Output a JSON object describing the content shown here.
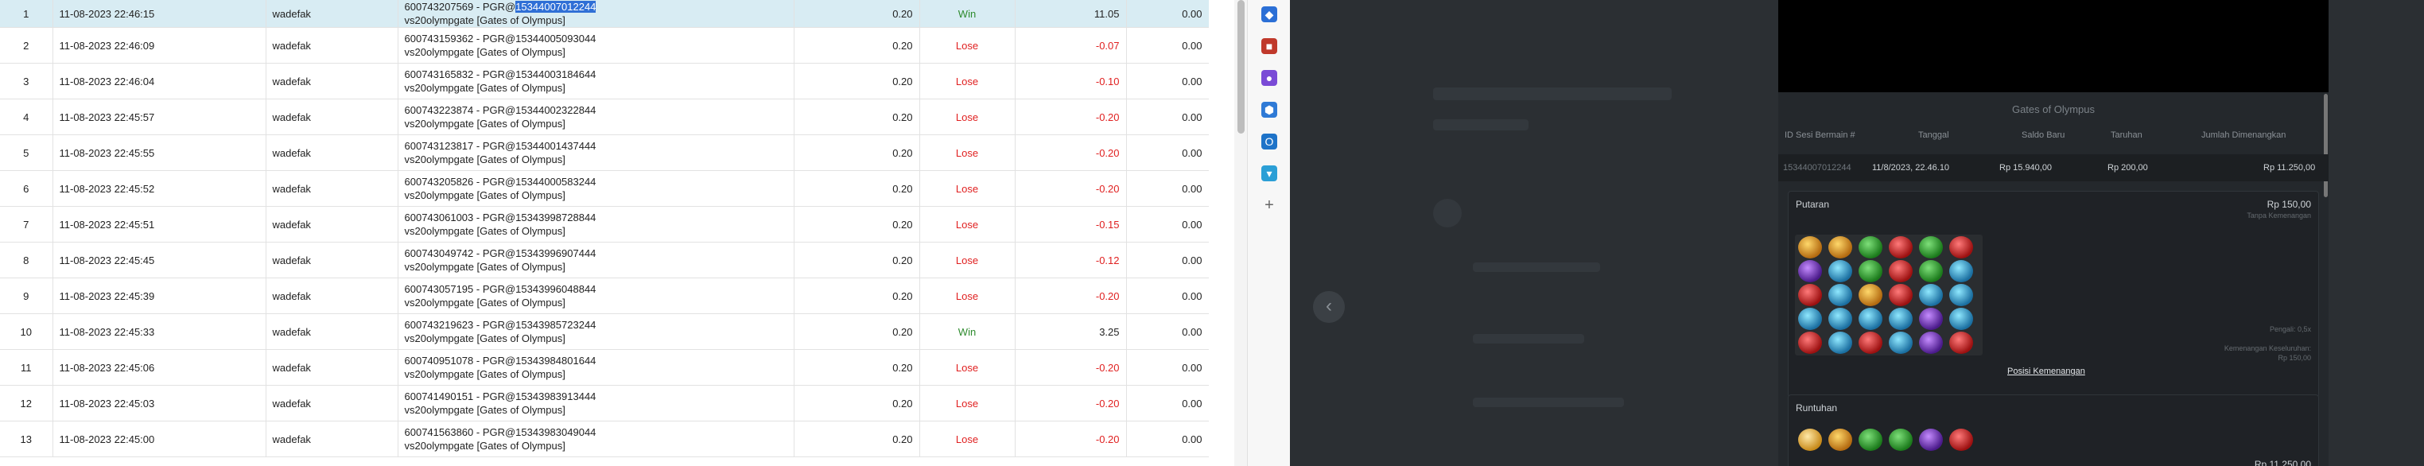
{
  "table": {
    "rows": [
      {
        "no": "1",
        "date": "11-08-2023 22:46:15",
        "user": "wadefak",
        "desc_prefix": "600743207569 - PGR@",
        "desc_hl": "15344007012244",
        "desc2": "vs20olympgate [Gates of Olympus]",
        "bet": "0.20",
        "result": "Win",
        "amount": "11.05",
        "balance": "0.00"
      },
      {
        "no": "2",
        "date": "11-08-2023 22:46:09",
        "user": "wadefak",
        "desc_prefix": "600743159362 - PGR@15344005093044",
        "desc_hl": "",
        "desc2": "vs20olympgate [Gates of Olympus]",
        "bet": "0.20",
        "result": "Lose",
        "amount": "-0.07",
        "balance": "0.00"
      },
      {
        "no": "3",
        "date": "11-08-2023 22:46:04",
        "user": "wadefak",
        "desc_prefix": "600743165832 - PGR@15344003184644",
        "desc_hl": "",
        "desc2": "vs20olympgate [Gates of Olympus]",
        "bet": "0.20",
        "result": "Lose",
        "amount": "-0.10",
        "balance": "0.00"
      },
      {
        "no": "4",
        "date": "11-08-2023 22:45:57",
        "user": "wadefak",
        "desc_prefix": "600743223874 - PGR@15344002322844",
        "desc_hl": "",
        "desc2": "vs20olympgate [Gates of Olympus]",
        "bet": "0.20",
        "result": "Lose",
        "amount": "-0.20",
        "balance": "0.00"
      },
      {
        "no": "5",
        "date": "11-08-2023 22:45:55",
        "user": "wadefak",
        "desc_prefix": "600743123817 - PGR@15344001437444",
        "desc_hl": "",
        "desc2": "vs20olympgate [Gates of Olympus]",
        "bet": "0.20",
        "result": "Lose",
        "amount": "-0.20",
        "balance": "0.00"
      },
      {
        "no": "6",
        "date": "11-08-2023 22:45:52",
        "user": "wadefak",
        "desc_prefix": "600743205826 - PGR@15344000583244",
        "desc_hl": "",
        "desc2": "vs20olympgate [Gates of Olympus]",
        "bet": "0.20",
        "result": "Lose",
        "amount": "-0.20",
        "balance": "0.00"
      },
      {
        "no": "7",
        "date": "11-08-2023 22:45:51",
        "user": "wadefak",
        "desc_prefix": "600743061003 - PGR@15343998728844",
        "desc_hl": "",
        "desc2": "vs20olympgate [Gates of Olympus]",
        "bet": "0.20",
        "result": "Lose",
        "amount": "-0.15",
        "balance": "0.00"
      },
      {
        "no": "8",
        "date": "11-08-2023 22:45:45",
        "user": "wadefak",
        "desc_prefix": "600743049742 - PGR@15343996907444",
        "desc_hl": "",
        "desc2": "vs20olympgate [Gates of Olympus]",
        "bet": "0.20",
        "result": "Lose",
        "amount": "-0.12",
        "balance": "0.00"
      },
      {
        "no": "9",
        "date": "11-08-2023 22:45:39",
        "user": "wadefak",
        "desc_prefix": "600743057195 - PGR@15343996048844",
        "desc_hl": "",
        "desc2": "vs20olympgate [Gates of Olympus]",
        "bet": "0.20",
        "result": "Lose",
        "amount": "-0.20",
        "balance": "0.00"
      },
      {
        "no": "10",
        "date": "11-08-2023 22:45:33",
        "user": "wadefak",
        "desc_prefix": "600743219623 - PGR@15343985723244",
        "desc_hl": "",
        "desc2": "vs20olympgate [Gates of Olympus]",
        "bet": "0.20",
        "result": "Win",
        "amount": "3.25",
        "balance": "0.00"
      },
      {
        "no": "11",
        "date": "11-08-2023 22:45:06",
        "user": "wadefak",
        "desc_prefix": "600740951078 - PGR@15343984801644",
        "desc_hl": "",
        "desc2": "vs20olympgate [Gates of Olympus]",
        "bet": "0.20",
        "result": "Lose",
        "amount": "-0.20",
        "balance": "0.00"
      },
      {
        "no": "12",
        "date": "11-08-2023 22:45:03",
        "user": "wadefak",
        "desc_prefix": "600741490151 - PGR@15343983913444",
        "desc_hl": "",
        "desc2": "vs20olympgate [Gates of Olympus]",
        "bet": "0.20",
        "result": "Lose",
        "amount": "-0.20",
        "balance": "0.00"
      },
      {
        "no": "13",
        "date": "11-08-2023 22:45:00",
        "user": "wadefak",
        "desc_prefix": "600741563860 - PGR@15343983049044",
        "desc_hl": "",
        "desc2": "vs20olympgate [Gates of Olympus]",
        "bet": "0.20",
        "result": "Lose",
        "amount": "-0.20",
        "balance": "0.00"
      }
    ]
  },
  "extensions": [
    {
      "icon": "tag-icon",
      "color": "#2b6fd6"
    },
    {
      "icon": "toolbox-icon",
      "color": "#c0392b"
    },
    {
      "icon": "people-icon",
      "color": "#7a4bd6"
    },
    {
      "icon": "hexagon-icon",
      "color": "#2f7ad6"
    },
    {
      "icon": "outlook-icon",
      "color": "#1e73c8"
    },
    {
      "icon": "cart-icon",
      "color": "#2b9fd6"
    },
    {
      "icon": "plus-icon",
      "color": "#666666"
    }
  ],
  "panel": {
    "title": "Gates of Olympus",
    "headers": {
      "id": "ID Sesi Bermain #",
      "tanggal": "Tanggal",
      "saldo": "Saldo Baru",
      "taruhan": "Taruhan",
      "menang": "Jumlah Dimenangkan"
    },
    "row": {
      "id": "15344007012244",
      "tanggal": "11/8/2023, 22.46.10",
      "saldo": "Rp 15.940,00",
      "taruhan": "Rp 200,00",
      "menang": "Rp 11.250,00"
    },
    "putaran": {
      "label": "Putaran",
      "amount": "Rp 150,00",
      "sublabel": "Tanpa Kemenangan",
      "pengali": "Pengali: 0,5x",
      "kemenangan": "Kemenangan Keseluruhan:",
      "kemenangan_val": "Rp 150,00",
      "link": "Posisi Kemenangan"
    },
    "runtuhan": {
      "label": "Runtuhan",
      "amount": "Rp 11.250,00"
    }
  },
  "colors": {
    "win": "#2e8b2e",
    "lose": "#e02020",
    "selected_row": "#d8ecf3",
    "highlight": "#2f6fd6",
    "dark_bg": "#2b2f33",
    "panel_bg": "#24282c"
  }
}
